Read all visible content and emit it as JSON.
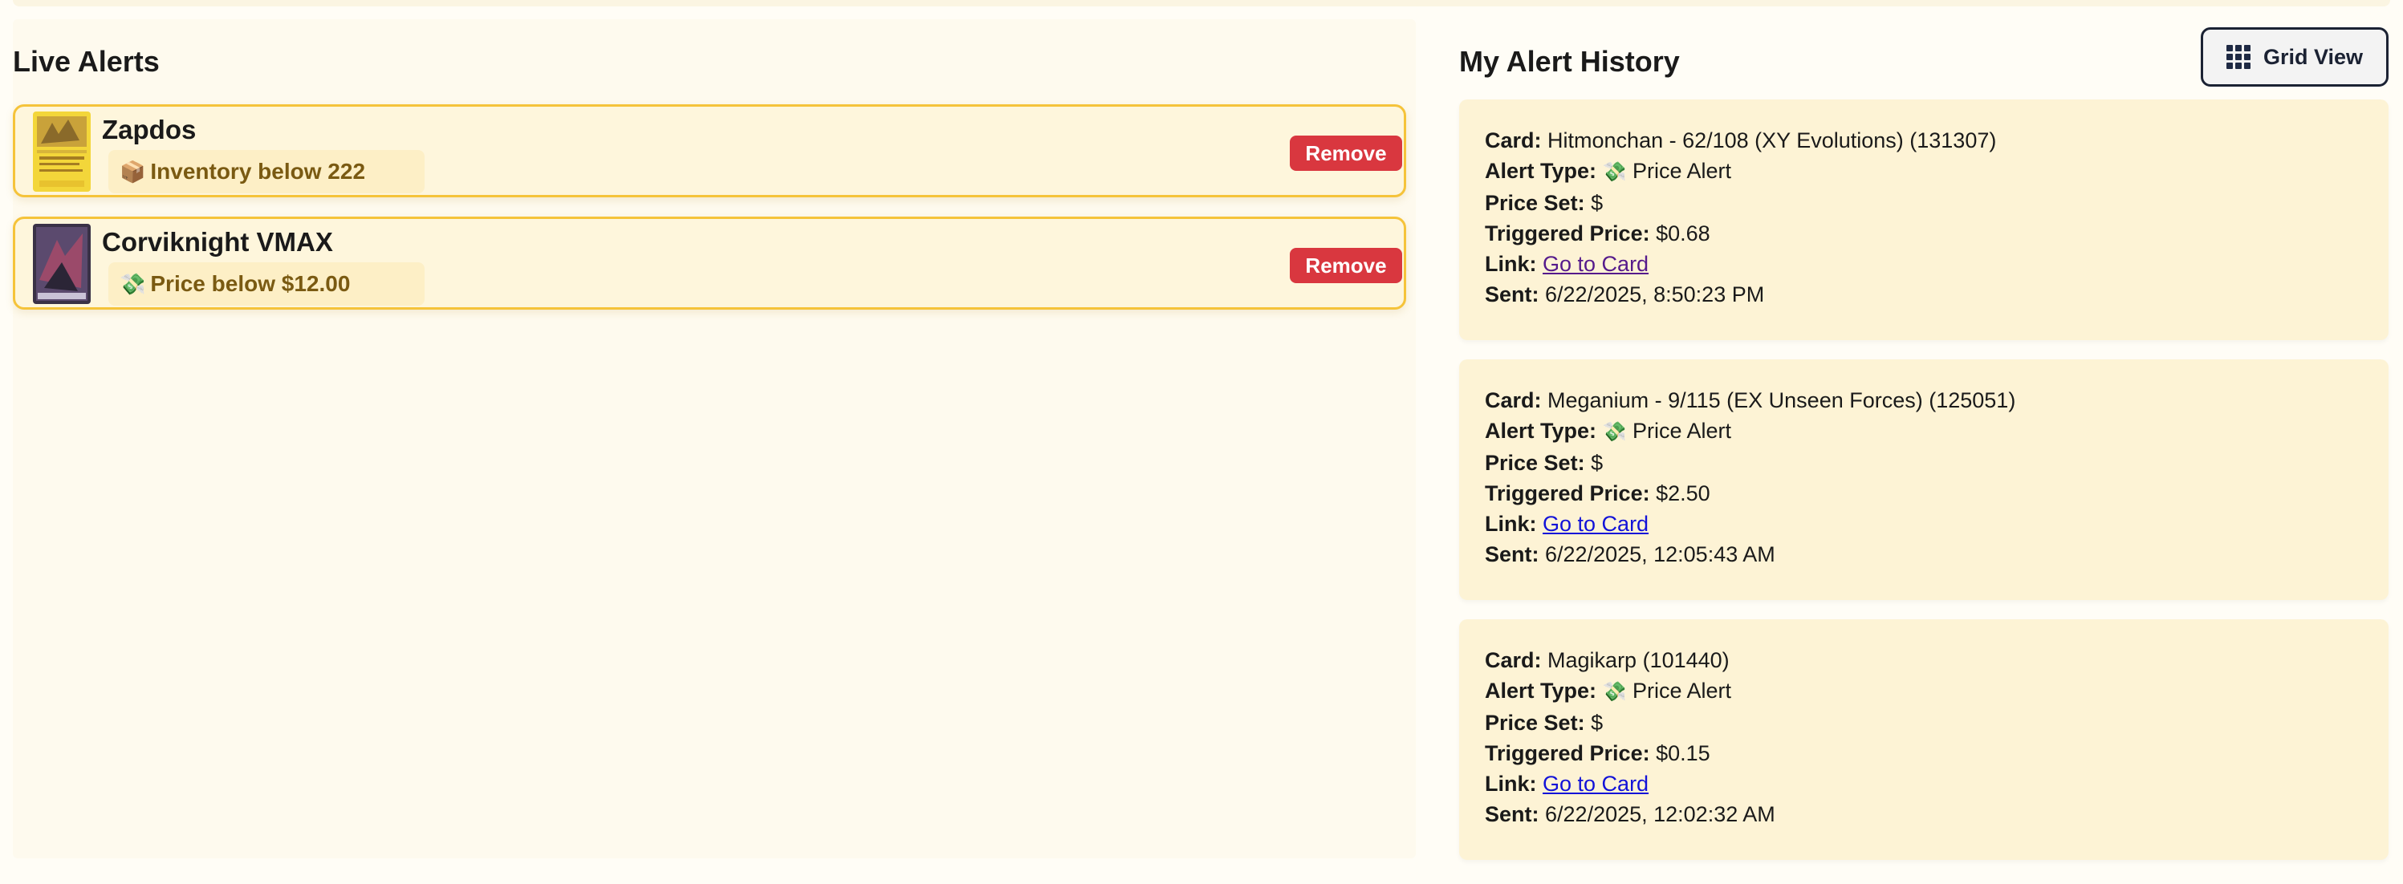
{
  "live_alerts": {
    "title": "Live Alerts",
    "items": [
      {
        "name": "Zapdos",
        "condition": "Inventory below 222",
        "icon": "package-icon",
        "remove_label": "Remove"
      },
      {
        "name": "Corviknight VMAX",
        "condition": "Price below $12.00",
        "icon": "money-icon",
        "remove_label": "Remove"
      }
    ]
  },
  "history": {
    "title": "My Alert History",
    "grid_view_label": "Grid View",
    "field_labels": {
      "card": "Card:",
      "alert_type": "Alert Type:",
      "price_set": "Price Set:",
      "triggered_price": "Triggered Price:",
      "link": "Link:",
      "sent": "Sent:"
    },
    "items": [
      {
        "card": "Hitmonchan - 62/108 (XY Evolutions) (131307)",
        "alert_type": "Price Alert",
        "price_set": "$",
        "triggered_price": "$0.68",
        "link_text": "Go to Card",
        "sent": "6/22/2025, 8:50:23 PM"
      },
      {
        "card": "Meganium - 9/115 (EX Unseen Forces) (125051)",
        "alert_type": "Price Alert",
        "price_set": "$",
        "triggered_price": "$2.50",
        "link_text": "Go to Card",
        "sent": "6/22/2025, 12:05:43 AM"
      },
      {
        "card": "Magikarp (101440)",
        "alert_type": "Price Alert",
        "price_set": "$",
        "triggered_price": "$0.15",
        "link_text": "Go to Card",
        "sent": "6/22/2025, 12:02:32 AM"
      }
    ]
  },
  "colors": {
    "alert_border": "#f5c33a",
    "remove_button": "#d9373f",
    "condition_text": "#7a5a12",
    "link": "#1212d8",
    "visited_link": "#551a8b"
  }
}
